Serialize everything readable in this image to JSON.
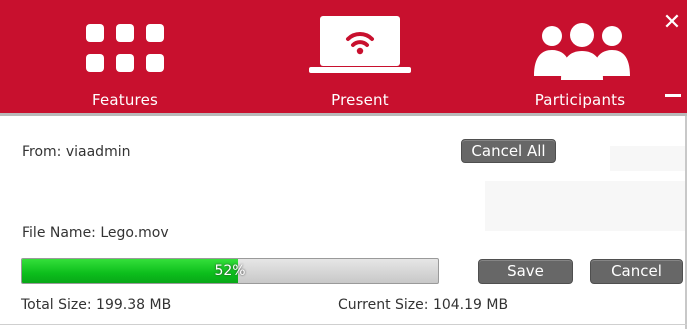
{
  "window": {
    "close_glyph": "✕",
    "accent_color": "#c8102e"
  },
  "nav": {
    "items": [
      {
        "label": "Features",
        "icon": "grid-icon"
      },
      {
        "label": "Present",
        "icon": "wifi-laptop-icon"
      },
      {
        "label": "Participants",
        "icon": "participants-icon"
      }
    ]
  },
  "transfer": {
    "from_text": "From: viaadmin",
    "cancel_all_label": "Cancel All",
    "file_name_text": "File Name: Lego.mov",
    "progress_percent": 52,
    "progress_text": "52%",
    "save_label": "Save",
    "cancel_label": "Cancel",
    "total_size_text": "Total Size: 199.38 MB",
    "current_size_text": "Current Size: 104.19 MB",
    "progress_color": "#0cbe1c",
    "button_color": "#676767"
  }
}
